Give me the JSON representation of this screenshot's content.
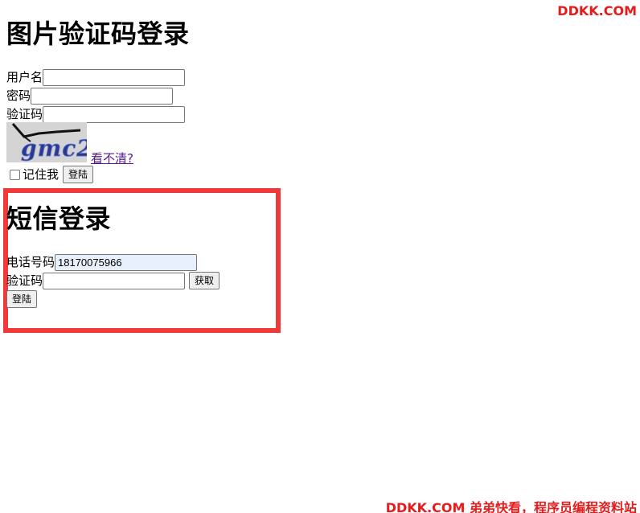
{
  "watermark": {
    "top": "DDKK.COM",
    "bottom": "DDKK.COM 弟弟快看，程序员编程资料站"
  },
  "image_login": {
    "title": "图片验证码登录",
    "username_label": "用户名",
    "password_label": "密码",
    "code_label": "验证码",
    "captcha_text": "gmc2",
    "refresh_link": "看不清?",
    "remember_label": "记住我",
    "login_button": "登陆"
  },
  "sms_login": {
    "title": "短信登录",
    "phone_label": "电话号码",
    "phone_value": "18170075966",
    "code_label": "验证码",
    "get_button": "获取",
    "login_button": "登陆"
  },
  "colors": {
    "highlight": "#f03a3a",
    "watermark": "#e41c1c",
    "link": "#551a8b",
    "autofill": "#e8f0fe"
  }
}
